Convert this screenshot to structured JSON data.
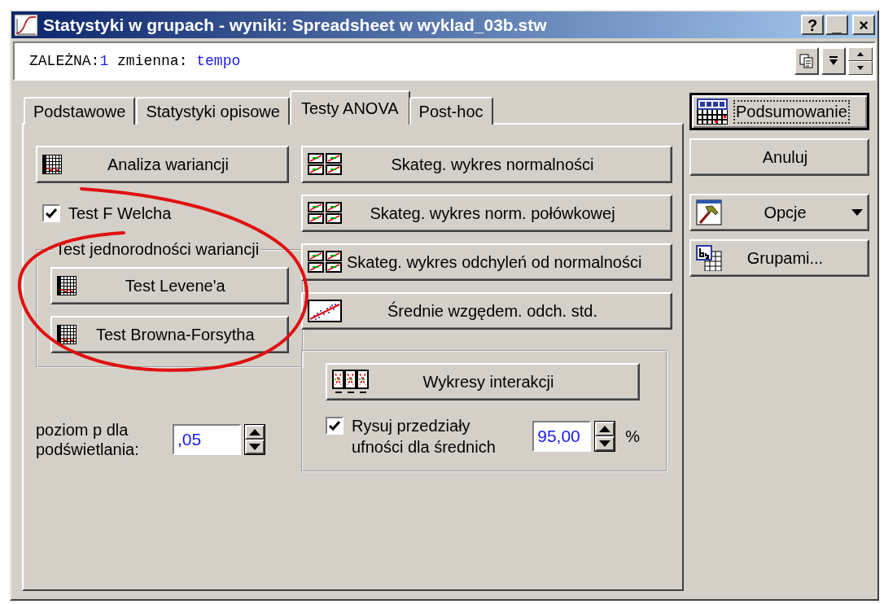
{
  "window": {
    "title": "Statystyki w grupach - wyniki: Spreadsheet w wyklad_03b.stw",
    "controls": [
      "?",
      "_",
      "×"
    ]
  },
  "variables_bar": {
    "label": "ZALEŻNA:",
    "count": "1",
    "text": "zmienna:",
    "value": "tempo"
  },
  "tabs": [
    {
      "label": "Podstawowe",
      "selected": false
    },
    {
      "label": "Statystyki opisowe",
      "selected": false
    },
    {
      "label": "Testy ANOVA",
      "selected": true
    },
    {
      "label": "Post-hoc",
      "selected": false
    }
  ],
  "left": {
    "buttons": [
      {
        "label": "Analiza wariancji",
        "kind": "table"
      }
    ],
    "checkbox": {
      "label": "Test F Welcha",
      "checked": true
    },
    "group": {
      "title": "Test jednorodności wariancji",
      "buttons": [
        {
          "label": "Test Levene'a",
          "kind": "table"
        },
        {
          "label": "Test Browna-Forsytha",
          "kind": "table"
        }
      ]
    },
    "p_level": {
      "label": "poziom p dla podświetlania:",
      "value": ",05"
    }
  },
  "middle": {
    "buttons": [
      {
        "label": "Skateg. wykres normalności",
        "kind": "charts"
      },
      {
        "label": "Skateg. wykres norm. połówkowej",
        "kind": "charts"
      },
      {
        "label": "Skateg. wykres odchyleń od normalności",
        "kind": "charts"
      },
      {
        "label": "Średnie wzgędem. odch. std.",
        "kind": "scatter"
      }
    ],
    "group": {
      "button": {
        "label": "Wykresy interakcji",
        "kind": "interaction"
      },
      "checkbox": {
        "label": "Rysuj przedziały ufności dla średnich",
        "checked": true
      },
      "confidence": {
        "value": "95,00",
        "unit": "%"
      }
    }
  },
  "right": {
    "buttons": [
      {
        "label": "Podsumowanie",
        "kind": "summary",
        "default": true
      },
      {
        "label": "Anuluj",
        "kind": "plain",
        "default": false
      },
      {
        "label": "Opcje",
        "kind": "tools",
        "default": false
      },
      {
        "label": "Grupami...",
        "kind": "grouping",
        "default": false
      }
    ]
  }
}
